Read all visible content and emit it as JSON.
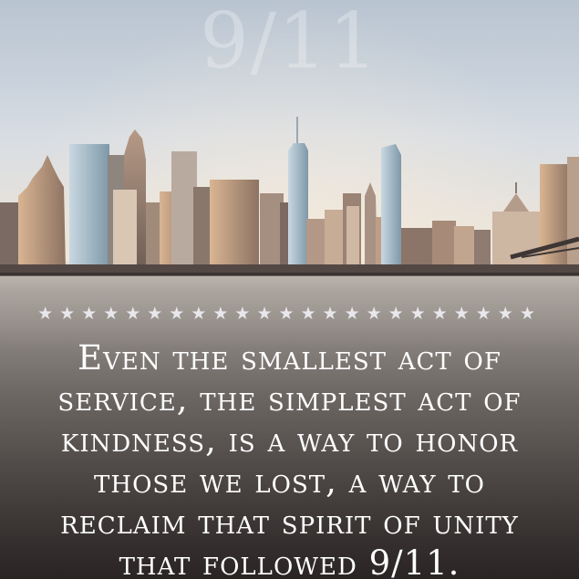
{
  "title": "9/11",
  "stars": "★★★★★★★★★★★★★★★★★★★★★★★",
  "quote": {
    "lines": [
      "Even the smallest act of",
      "service, the simplest act of",
      "kindness, is a way to honor",
      "those we lost, a way to",
      "reclaim that spirit of unity",
      "that followed 9/11."
    ]
  },
  "colors": {
    "sky_top": "#b9c4d1",
    "horizon": "#efe6d9",
    "bottom": "#2a2524",
    "text": "#ffffff"
  }
}
